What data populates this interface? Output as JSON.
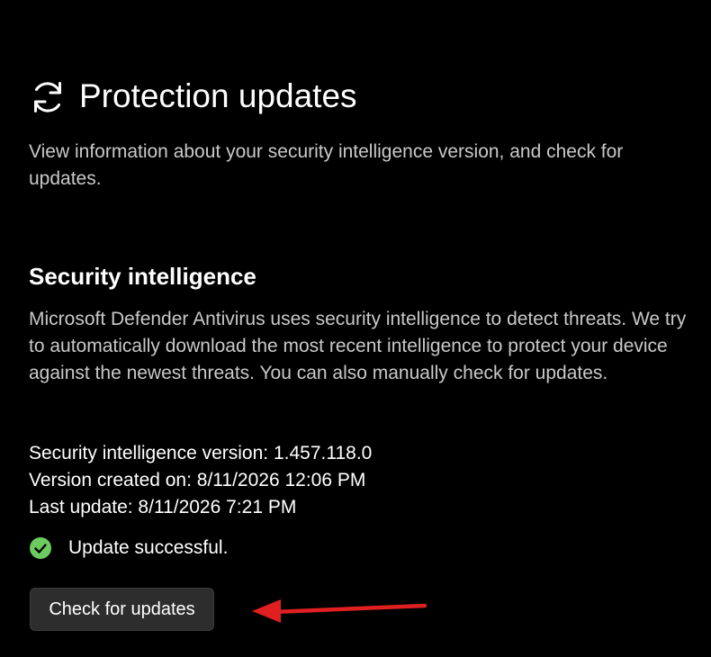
{
  "header": {
    "title": "Protection updates",
    "icon": "refresh-icon"
  },
  "page_description": "View information about your security intelligence version, and check for updates.",
  "security_intelligence": {
    "title": "Security intelligence",
    "description": "Microsoft Defender Antivirus uses security intelligence to detect threats. We try to automatically download the most recent intelligence to protect your device against the newest threats. You can also manually check for updates.",
    "version_line": "Security intelligence version: 1.457.118.0",
    "created_line": "Version created on: 8/11/2026 12:06 PM",
    "last_update_line": "Last update: 8/11/2026 7:21 PM"
  },
  "status": {
    "icon": "checkmark-circle-icon",
    "text": "Update successful.",
    "color": "#6ccb5f"
  },
  "actions": {
    "check_label": "Check for updates"
  },
  "annotation": {
    "icon": "red-arrow-icon",
    "color": "#e02020"
  }
}
